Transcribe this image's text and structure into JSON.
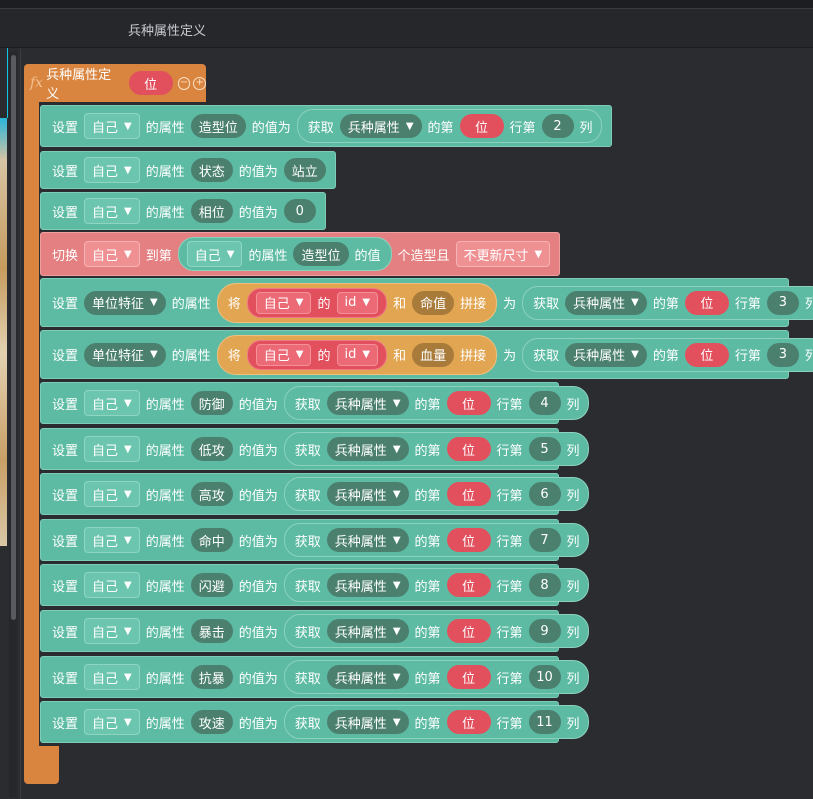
{
  "window": {
    "tab_title": "兵种属性定义"
  },
  "function": {
    "title": "兵种属性定义",
    "param": "位",
    "fx_label": "fx",
    "remove_label": "−",
    "add_label": "+"
  },
  "words": {
    "set": "设置",
    "attr_of": "的属性",
    "value_is": "的值为",
    "get": "获取",
    "nth": "的第",
    "row_nth": "行第",
    "col": "列",
    "switch": "切换",
    "to_nth": "到第",
    "value": "的值",
    "nth_shape_and": "个造型且",
    "of": "的",
    "and": "和",
    "concat": "拼接",
    "as": "为",
    "join": "将"
  },
  "dropdowns": {
    "self": "自己",
    "unit_feature": "单位特征",
    "troop_attr": "兵种属性",
    "no_resize": "不更新尺寸"
  },
  "blocks": [
    {
      "attr": "造型位",
      "row": "位",
      "col": "2"
    },
    {
      "attr": "状态",
      "value": "站立"
    },
    {
      "attr": "相位",
      "value": "0"
    },
    {
      "switch_attr": "造型位"
    },
    {
      "id_label": "id",
      "suffix": "命值",
      "row": "位",
      "col": "3"
    },
    {
      "id_label": "id",
      "suffix": "血量",
      "row": "位",
      "col": "3"
    },
    {
      "attr": "防御",
      "row": "位",
      "col": "4"
    },
    {
      "attr": "低攻",
      "row": "位",
      "col": "5"
    },
    {
      "attr": "高攻",
      "row": "位",
      "col": "6"
    },
    {
      "attr": "命中",
      "row": "位",
      "col": "7"
    },
    {
      "attr": "闪避",
      "row": "位",
      "col": "8"
    },
    {
      "attr": "暴击",
      "row": "位",
      "col": "9"
    },
    {
      "attr": "抗暴",
      "row": "位",
      "col": "10"
    },
    {
      "attr": "攻速",
      "row": "位",
      "col": "11"
    }
  ],
  "colors": {
    "teal": "#5dbba3",
    "orange_func": "#d9843f",
    "red": "#e2505e",
    "pink": "#e58082",
    "dark_pill": "#4b806f"
  }
}
